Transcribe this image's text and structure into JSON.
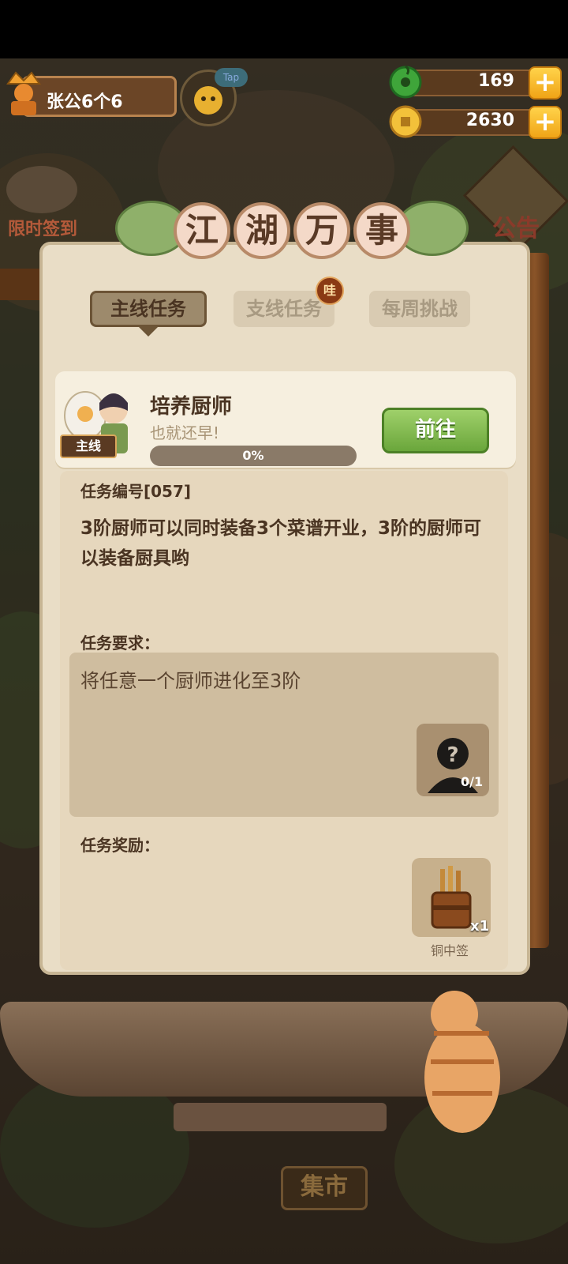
{
  "player": {
    "name": "张公6个6"
  },
  "tap_badge": "Tap",
  "currency": {
    "jade": {
      "icon": "jade-coin-icon",
      "value": "169"
    },
    "coins": {
      "icon": "gold-coin-icon",
      "value": "2630"
    }
  },
  "side_menu": {
    "left_label": "限时签到",
    "right_label": "公告"
  },
  "dialog": {
    "title_chars": [
      "江",
      "湖",
      "万",
      "事"
    ],
    "tabs": [
      {
        "label": "主线任务",
        "active": true
      },
      {
        "label": "支线任务",
        "active": false
      },
      {
        "label": "每周挑战",
        "active": false
      }
    ],
    "tab_badge": "哇",
    "quest": {
      "tag": "主线",
      "title": "培养厨师",
      "subtitle": "也就还早!",
      "progress_text": "0%",
      "progress_fraction": 0,
      "go_label": "前往"
    },
    "task_number_label": "任务编号[057]",
    "description": "3阶厨师可以同时装备3个菜谱开业，3阶的厨师可以装备厨具哟",
    "requirement_label": "任务要求：",
    "requirement_text": "将任意一个厨师进化至3阶",
    "requirement_progress": "0/1",
    "reward_label": "任务奖励：",
    "reward": {
      "count": "x1",
      "name": "铜中签"
    }
  },
  "bottom": {
    "market_sign": "集市"
  },
  "colors": {
    "accent_green": "#6aa63b",
    "panel": "#e9ddc6",
    "text_dark": "#4a3422"
  }
}
